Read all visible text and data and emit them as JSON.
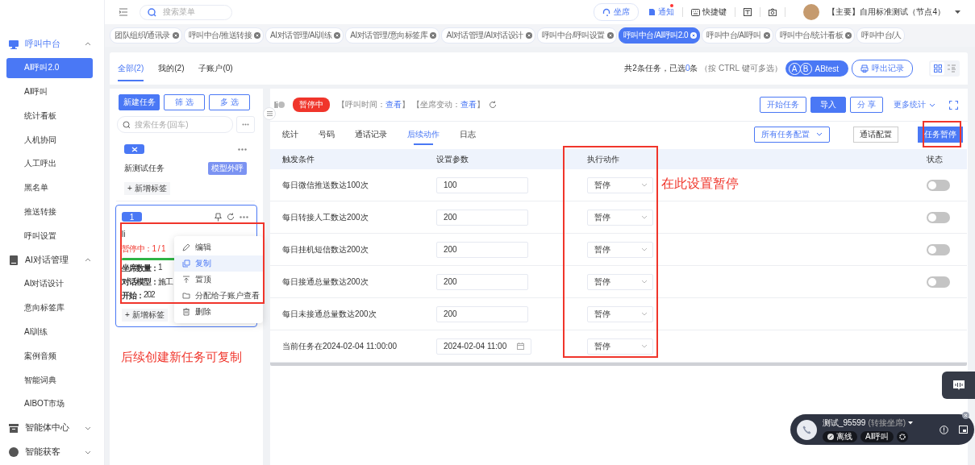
{
  "sidebar": {
    "groups": [
      {
        "label": "呼叫中台",
        "expanded": true,
        "items": [
          {
            "label": "AI呼叫2.0",
            "selected": true
          },
          {
            "label": "AI呼叫",
            "selected": false
          },
          {
            "label": "统计看板",
            "selected": false
          },
          {
            "label": "人机协同",
            "selected": false
          },
          {
            "label": "人工呼出",
            "selected": false
          },
          {
            "label": "黑名单",
            "selected": false
          },
          {
            "label": "推送转接",
            "selected": false
          },
          {
            "label": "呼叫设置",
            "selected": false
          }
        ]
      },
      {
        "label": "AI对话管理",
        "expanded": true,
        "items": [
          {
            "label": "AI对话设计",
            "selected": false
          },
          {
            "label": "意向标签库",
            "selected": false
          },
          {
            "label": "AI训练",
            "selected": false
          },
          {
            "label": "案例音频",
            "selected": false
          },
          {
            "label": "智能词典",
            "selected": false
          },
          {
            "label": "AIBOT市场",
            "selected": false
          }
        ]
      },
      {
        "label": "智能体中心",
        "expanded": false
      },
      {
        "label": "智能获客",
        "expanded": false
      }
    ]
  },
  "header": {
    "search_placeholder": "搜索菜单",
    "agent_button": "坐席",
    "notice": {
      "label": "通知",
      "unread": true
    },
    "shortcut_button": "快捷键",
    "account": "【主要】自用标准测试（节点4）"
  },
  "open_tabs": [
    {
      "label": "团队组织/通讯录",
      "selected": false
    },
    {
      "label": "呼叫中台/推送转接",
      "selected": false
    },
    {
      "label": "AI对话管理/AI训练",
      "selected": false
    },
    {
      "label": "AI对话管理/意向标签库",
      "selected": false
    },
    {
      "label": "AI对话管理/AI对话设计",
      "selected": false
    },
    {
      "label": "呼叫中台/呼叫设置",
      "selected": false
    },
    {
      "label": "呼叫中台/AI呼叫2.0",
      "selected": true
    },
    {
      "label": "呼叫中台/AI呼叫",
      "selected": false
    },
    {
      "label": "呼叫中台/统计看板",
      "selected": false
    },
    {
      "label": "呼叫中台/人",
      "selected": false
    }
  ],
  "toolbar": {
    "tabs": [
      {
        "label": "全部(2)",
        "selected": true
      },
      {
        "label": "我的(2)",
        "selected": false
      },
      {
        "label": "子账户(0)",
        "selected": false
      }
    ],
    "summary": {
      "before": "共2条任务，已选",
      "count": "0",
      "after": "条",
      "hint": "（按 CTRL 键可多选）"
    },
    "ab_button": {
      "letters": [
        "A",
        "B"
      ],
      "label": "ABtest"
    },
    "records_button": "呼出记录",
    "view_modes": [
      {
        "kind": "grid",
        "selected": true
      },
      {
        "kind": "list",
        "selected": false
      }
    ]
  },
  "task_list": {
    "buttons": [
      {
        "label": "新建任务",
        "kind": "primary"
      },
      {
        "label": "筛 选",
        "kind": "outline"
      },
      {
        "label": "多 选",
        "kind": "outline"
      }
    ],
    "search_placeholder": "搜索任务(回车)",
    "tasks": [
      {
        "badge": {
          "kind": "icon"
        },
        "title": "新测试任务",
        "tag": "模型外呼",
        "add_tag": "+ 新增标签",
        "selected": false
      },
      {
        "badge": {
          "kind": "text",
          "label": "1"
        },
        "title": "li",
        "status": "暂停中：1 / 1",
        "level": 1,
        "fields": [
          {
            "label": "坐席数量：",
            "value": "1"
          },
          {
            "label": "对话模型：",
            "value": "施工"
          },
          {
            "label": "开始：",
            "value": "202"
          }
        ],
        "add_tag": "+ 新增标签",
        "selected": true
      }
    ]
  },
  "context_menu": {
    "items": [
      {
        "label": "编辑",
        "kind": "edit",
        "selected": false
      },
      {
        "label": "复制",
        "kind": "copy",
        "selected": true
      },
      {
        "label": "置顶",
        "kind": "top",
        "selected": false
      },
      {
        "label": "分配给子账户查看",
        "kind": "folder",
        "selected": false
      },
      {
        "label": "删除",
        "kind": "trash",
        "selected": false
      }
    ]
  },
  "detail": {
    "name": "li",
    "status": "暂停中",
    "meta": [
      {
        "before": "【呼叫时间：",
        "link": "查看",
        "after": "】"
      },
      {
        "before": "【坐席变动：",
        "link": "查看",
        "after": "】"
      }
    ],
    "actions": [
      {
        "label": "开始任务",
        "kind": "outline"
      },
      {
        "label": "导入",
        "kind": "primary"
      },
      {
        "label": "分 享",
        "kind": "outline"
      },
      {
        "label": "更多统计",
        "kind": "dropdown"
      }
    ],
    "tabs": [
      {
        "label": "统计",
        "selected": false
      },
      {
        "label": "号码",
        "selected": false
      },
      {
        "label": "通话记录",
        "selected": false
      },
      {
        "label": "后续动作",
        "selected": true
      },
      {
        "label": "日志",
        "selected": false
      }
    ],
    "config_dropdown": "所有任务配置",
    "config_segments": [
      {
        "label": "通话配置",
        "selected": false
      },
      {
        "label": "任务暂停",
        "selected": true
      }
    ],
    "table": {
      "columns": [
        "触发条件",
        "设置参数",
        "执行动作",
        "状态"
      ],
      "rows": [
        {
          "kind": "number",
          "condition": "每日微信推送数达100次",
          "param": "100",
          "action": "暂停",
          "on": false
        },
        {
          "kind": "number",
          "condition": "每日转接人工数达200次",
          "param": "200",
          "action": "暂停",
          "on": false
        },
        {
          "kind": "number",
          "condition": "每日挂机短信数达200次",
          "param": "200",
          "action": "暂停",
          "on": false
        },
        {
          "kind": "number",
          "condition": "每日接通总量数达200次",
          "param": "200",
          "action": "暂停",
          "on": false
        },
        {
          "kind": "number",
          "condition": "每日未接通总量数达200次",
          "param": "200",
          "action": "暂停"
        },
        {
          "kind": "date",
          "condition": "当前任务在2024-02-04 11:00:00",
          "param": "2024-02-04 11:00",
          "action": "暂停"
        }
      ]
    }
  },
  "annotations": [
    {
      "text": "后续创建新任务可复制"
    },
    {
      "text": "在此设置暂停"
    }
  ],
  "call_widget": {
    "name": "测试_95599",
    "mode": "(转接坐席)",
    "chips": [
      {
        "label": "离线",
        "kind": "status"
      },
      {
        "label": "AI呼叫",
        "kind": "plain"
      }
    ]
  }
}
